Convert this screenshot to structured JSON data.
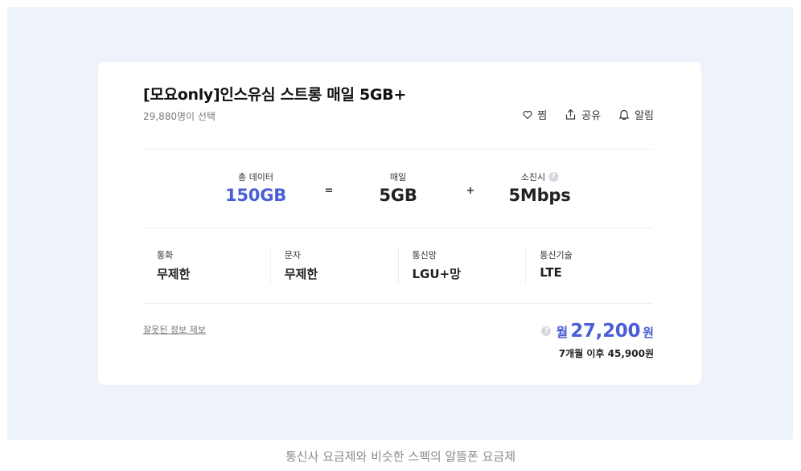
{
  "plan": {
    "title": "[모요only]인스유심 스트롱 매일 5GB+",
    "selected_count": "29,880명이 선택"
  },
  "actions": {
    "like_label": "찜",
    "share_label": "공유",
    "alert_label": "알림"
  },
  "data_usage": {
    "total_label": "총 데이터",
    "total_value": "150GB",
    "equals": "=",
    "daily_label": "매일",
    "daily_value": "5GB",
    "plus": "+",
    "exhausted_label": "소진시",
    "exhausted_value": "5Mbps"
  },
  "specs": [
    {
      "label": "통화",
      "value": "무제한"
    },
    {
      "label": "문자",
      "value": "무제한"
    },
    {
      "label": "통신망",
      "value": "LGU+망"
    },
    {
      "label": "통신기술",
      "value": "LTE"
    }
  ],
  "report_link": "잘못된 정보 제보",
  "price": {
    "prefix": "월",
    "amount": "27,200",
    "suffix": "원",
    "after": "7개월 이후 45,900원"
  },
  "caption": "통신사 요금제와 비슷한 스펙의 알뜰폰 요금제",
  "colors": {
    "accent": "#4a5fd6",
    "background": "#eef2fb"
  },
  "icons": [
    "heart-icon",
    "share-icon",
    "bell-icon",
    "help-icon"
  ]
}
